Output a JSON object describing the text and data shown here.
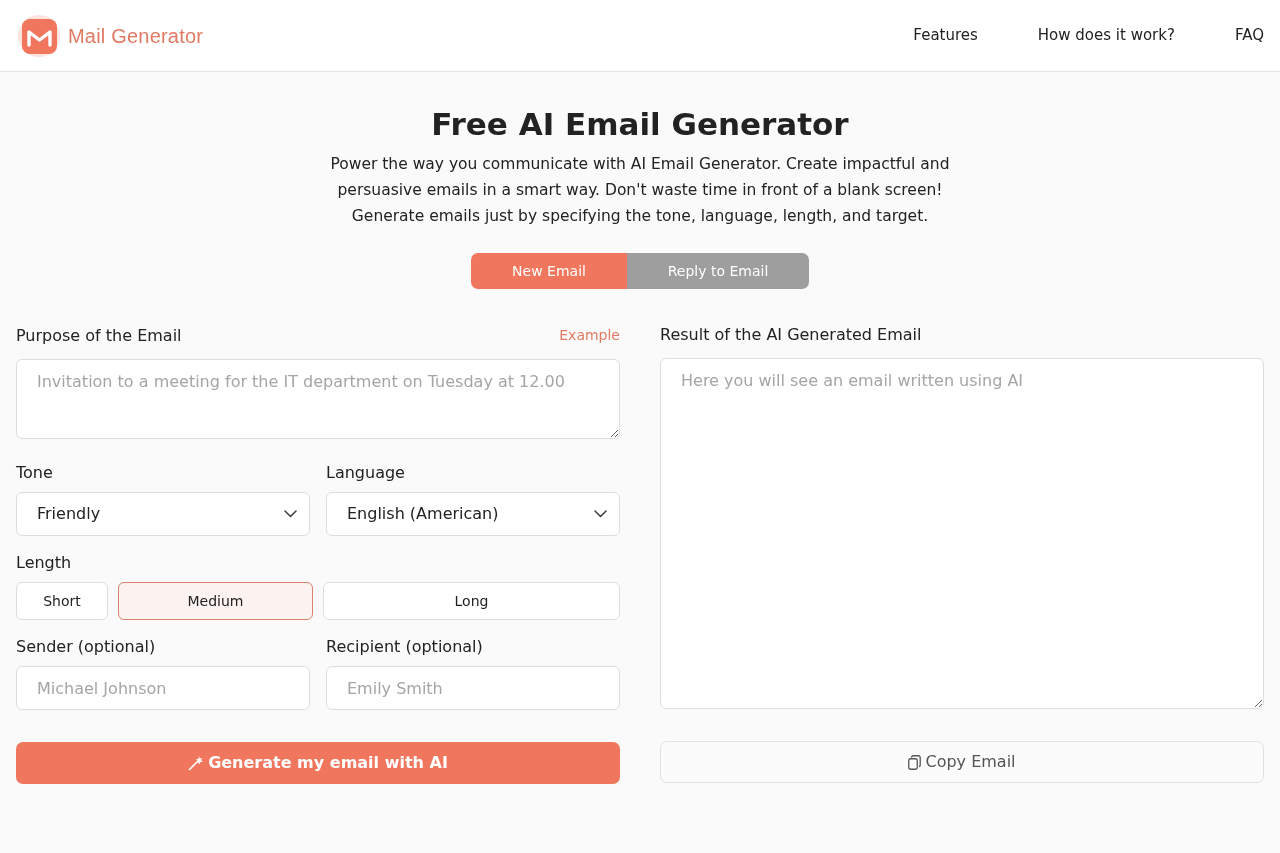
{
  "header": {
    "logo_text": "Mail Generator",
    "nav": [
      "Features",
      "How does it work?",
      "FAQ"
    ]
  },
  "hero": {
    "title": "Free AI Email Generator",
    "subtitle": "Power the way you communicate with AI Email Generator. Create impactful and persuasive emails in a smart way. Don't waste time in front of a blank screen! Generate emails just by specifying the tone, language, length, and target."
  },
  "mode_tabs": [
    {
      "label": "New Email",
      "selected": true
    },
    {
      "label": "Reply to Email",
      "selected": false
    }
  ],
  "form": {
    "purpose": {
      "label": "Purpose of the Email",
      "example_link": "Example",
      "placeholder": "Invitation to a meeting for the IT department on Tuesday at 12.00"
    },
    "tone": {
      "label": "Tone",
      "value": "Friendly"
    },
    "language": {
      "label": "Language",
      "value": "English (American)"
    },
    "length": {
      "label": "Length",
      "options": [
        {
          "label": "Short",
          "selected": false
        },
        {
          "label": "Medium",
          "selected": true
        },
        {
          "label": "Long",
          "selected": false
        }
      ]
    },
    "sender": {
      "label": "Sender (optional)",
      "placeholder": "Michael Johnson"
    },
    "recipient": {
      "label": "Recipient (optional)",
      "placeholder": "Emily Smith"
    },
    "generate_button": "Generate my email with AI"
  },
  "result": {
    "label": "Result of the AI Generated Email",
    "placeholder": "Here you will see an email written using AI",
    "copy_button": "Copy Email"
  }
}
